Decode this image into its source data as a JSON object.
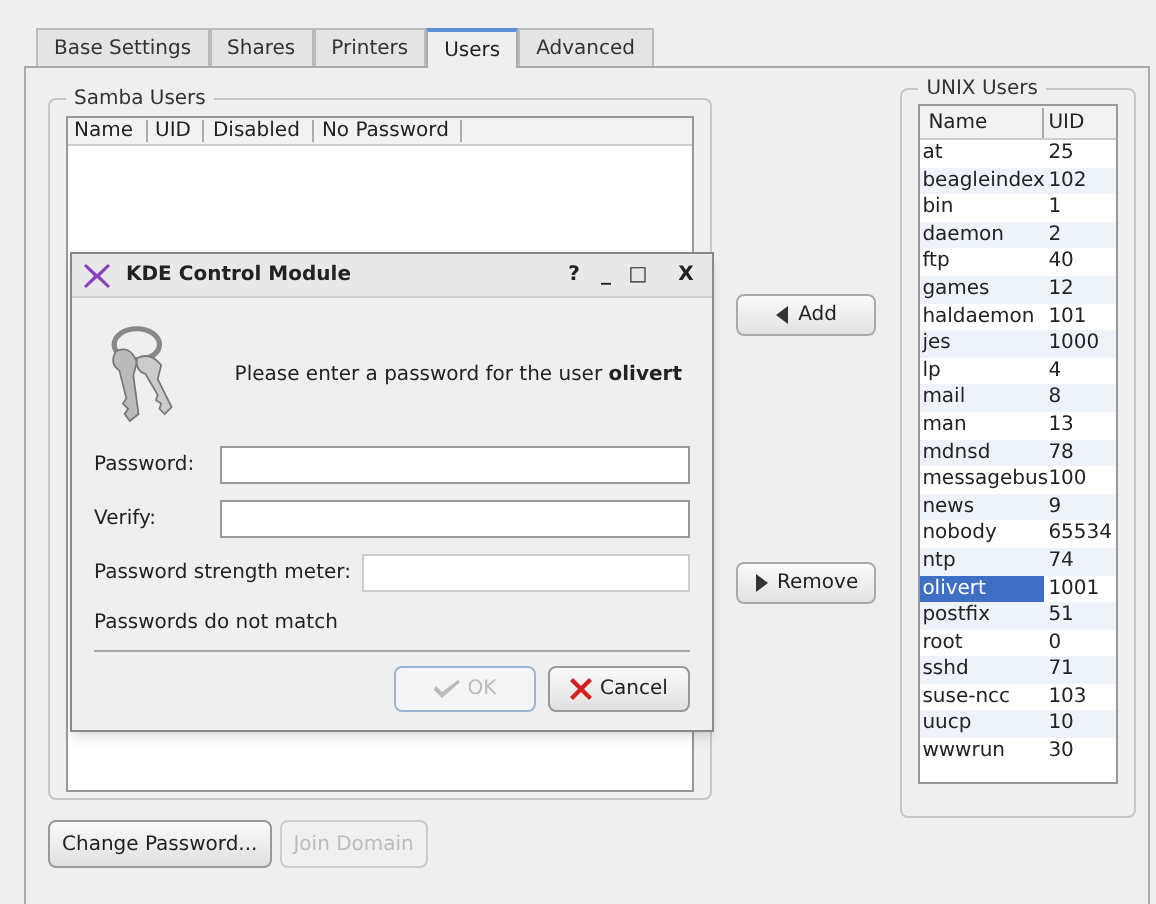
{
  "tabs": [
    {
      "label": "Base Settings",
      "selected": false
    },
    {
      "label": "Shares",
      "selected": false
    },
    {
      "label": "Printers",
      "selected": false
    },
    {
      "label": "Users",
      "selected": true
    },
    {
      "label": "Advanced",
      "selected": false
    }
  ],
  "samba_users": {
    "title": "Samba Users",
    "columns": [
      "Name",
      "UID",
      "Disabled",
      "No Password"
    ]
  },
  "add_button": "Add",
  "remove_button": "Remove",
  "unix_users": {
    "title": "UNIX Users",
    "columns": [
      "Name",
      "UID"
    ],
    "rows": [
      {
        "name": "at",
        "uid": "25",
        "selected": false
      },
      {
        "name": "beagleindex",
        "uid": "102",
        "selected": false
      },
      {
        "name": "bin",
        "uid": "1",
        "selected": false
      },
      {
        "name": "daemon",
        "uid": "2",
        "selected": false
      },
      {
        "name": "ftp",
        "uid": "40",
        "selected": false
      },
      {
        "name": "games",
        "uid": "12",
        "selected": false
      },
      {
        "name": "haldaemon",
        "uid": "101",
        "selected": false
      },
      {
        "name": "jes",
        "uid": "1000",
        "selected": false
      },
      {
        "name": "lp",
        "uid": "4",
        "selected": false
      },
      {
        "name": "mail",
        "uid": "8",
        "selected": false
      },
      {
        "name": "man",
        "uid": "13",
        "selected": false
      },
      {
        "name": "mdnsd",
        "uid": "78",
        "selected": false
      },
      {
        "name": "messagebus",
        "uid": "100",
        "selected": false
      },
      {
        "name": "news",
        "uid": "9",
        "selected": false
      },
      {
        "name": "nobody",
        "uid": "65534",
        "selected": false
      },
      {
        "name": "ntp",
        "uid": "74",
        "selected": false
      },
      {
        "name": "olivert",
        "uid": "1001",
        "selected": true
      },
      {
        "name": "postfix",
        "uid": "51",
        "selected": false
      },
      {
        "name": "root",
        "uid": "0",
        "selected": false
      },
      {
        "name": "sshd",
        "uid": "71",
        "selected": false
      },
      {
        "name": "suse-ncc",
        "uid": "103",
        "selected": false
      },
      {
        "name": "uucp",
        "uid": "10",
        "selected": false
      },
      {
        "name": "wwwrun",
        "uid": "30",
        "selected": false
      }
    ]
  },
  "bottom_buttons": [
    {
      "label": "Change Password...",
      "disabled": false
    },
    {
      "label": "Join Domain",
      "disabled": true
    }
  ],
  "dialog": {
    "title": "KDE Control Module",
    "title_buttons": [
      "?",
      "_",
      "□",
      "X"
    ],
    "message": "Please enter a password for the user **olivert**",
    "fields": [
      {
        "label": "Password:",
        "kind": "input"
      },
      {
        "label": "Verify:",
        "kind": "input"
      },
      {
        "label": "Password strength meter:",
        "kind": "meter",
        "level": 0
      }
    ],
    "status": "Passwords do not match",
    "buttons": [
      {
        "label": "OK",
        "kind": "ok",
        "disabled": true
      },
      {
        "label": "Cancel",
        "kind": "cancel",
        "disabled": false
      }
    ]
  }
}
